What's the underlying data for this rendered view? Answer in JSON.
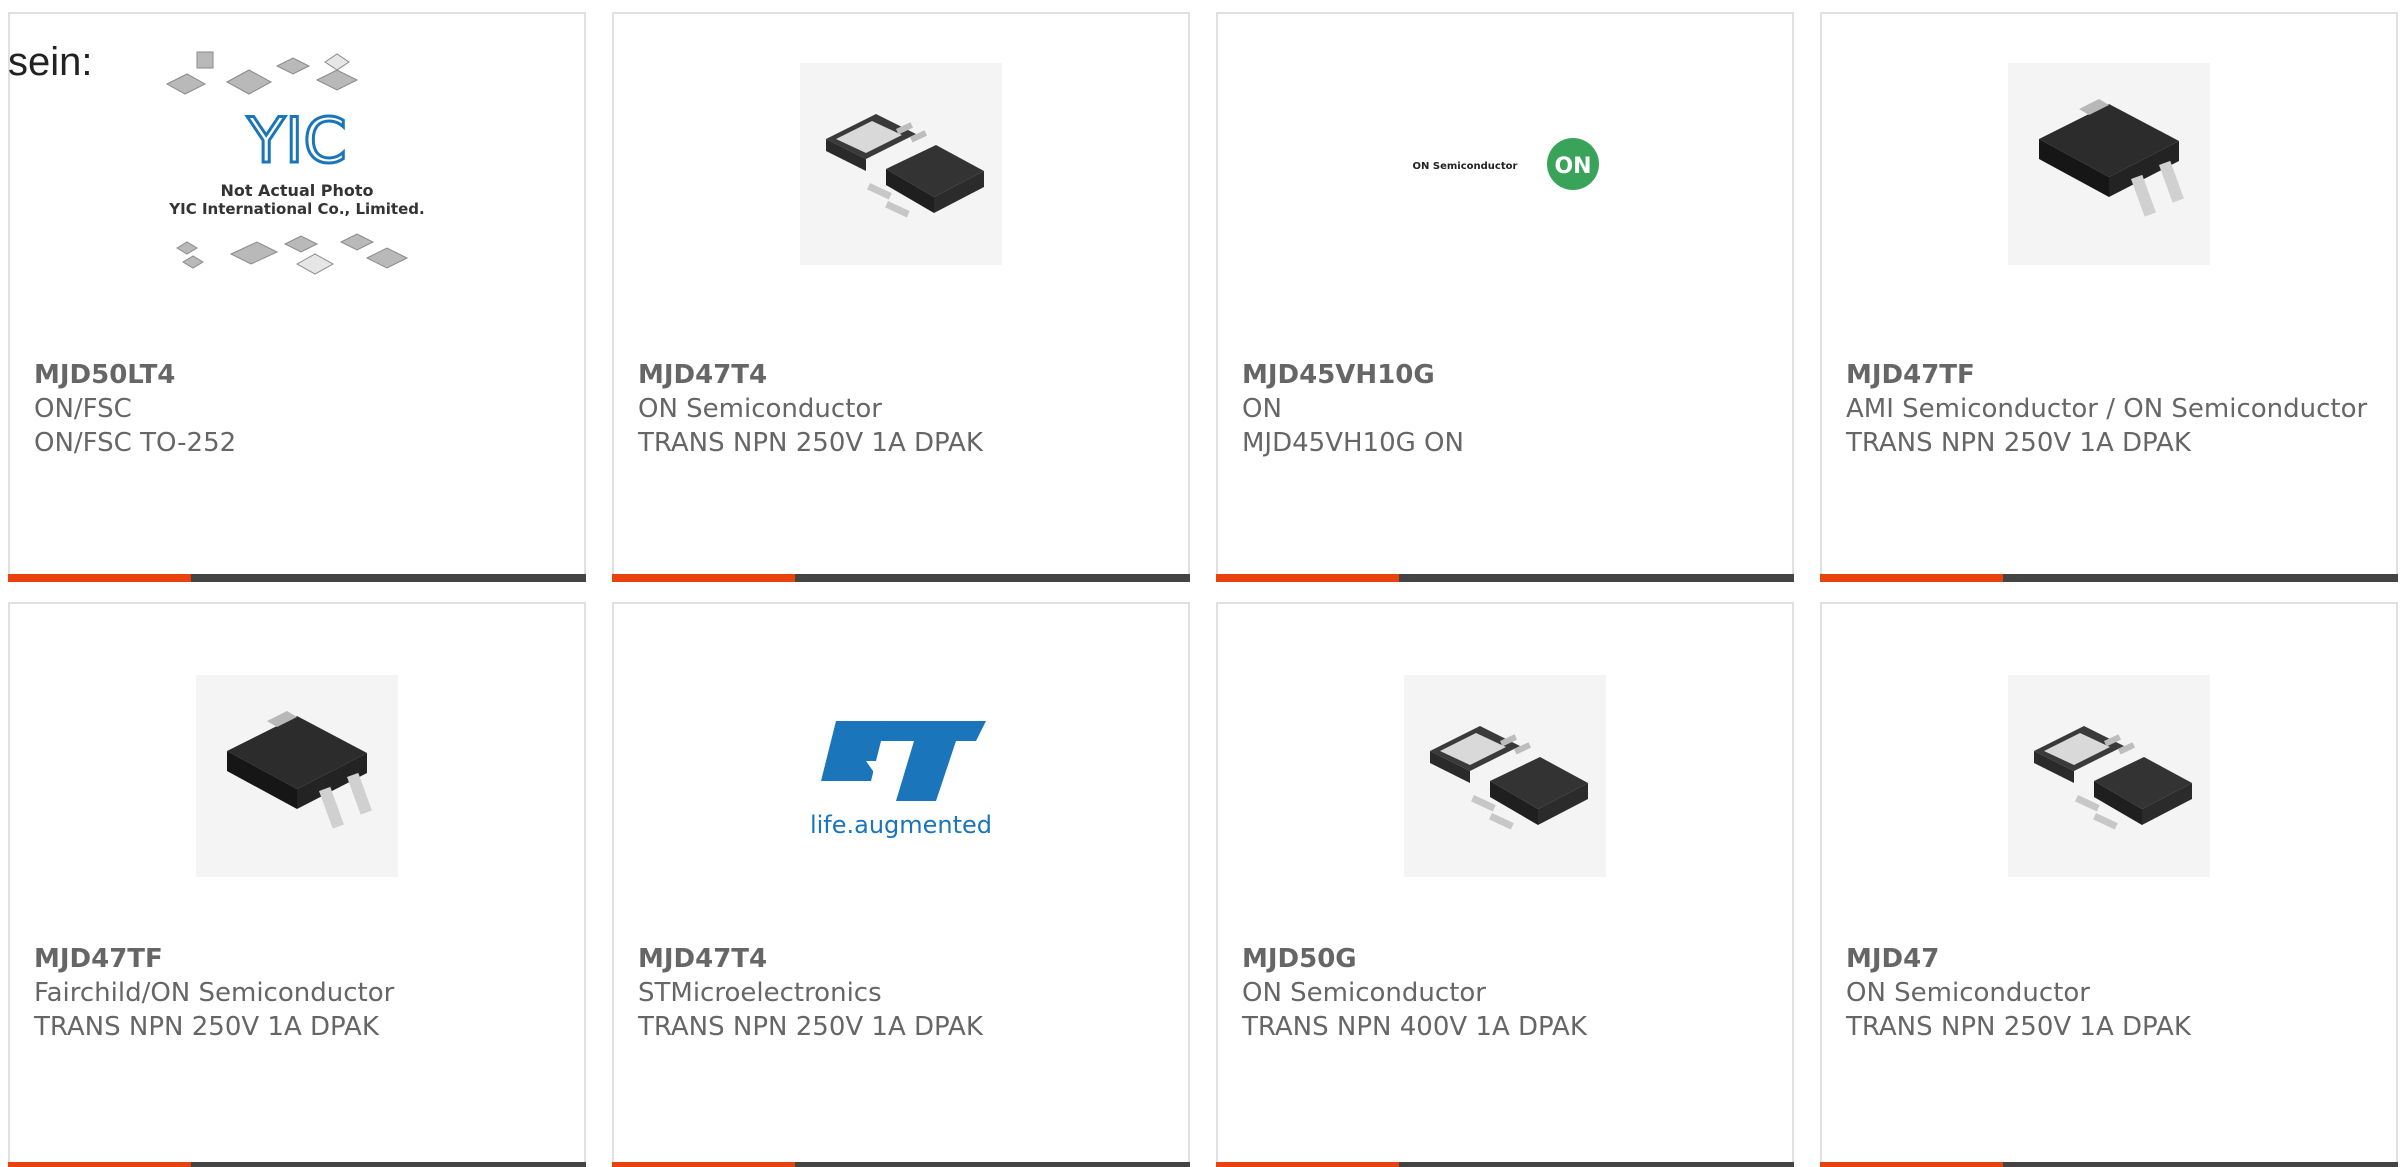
{
  "heading": "sein:",
  "colors": {
    "accent": "#e8430f",
    "bar": "#444444",
    "border": "#e0e0e0",
    "text": "#666666",
    "on_green": "#3aa35a",
    "st_blue": "#1b75bb"
  },
  "placeholder": {
    "logo_text": "YIC",
    "line1": "Not Actual Photo",
    "line2": "YIC International Co., Limited."
  },
  "on_logo": {
    "wordmark": "ON Semiconductor",
    "badge": "ON"
  },
  "st_logo": {
    "tagline": "life.augmented"
  },
  "products": [
    {
      "part": "MJD50LT4",
      "manufacturer": "ON/FSC",
      "description": "ON/FSC TO-252",
      "image": "yic-placeholder"
    },
    {
      "part": "MJD47T4",
      "manufacturer": "ON Semiconductor",
      "description": "TRANS NPN 250V 1A DPAK",
      "image": "dpak-pair"
    },
    {
      "part": "MJD45VH10G",
      "manufacturer": "ON",
      "description": "MJD45VH10G ON",
      "image": "on-semiconductor-logo"
    },
    {
      "part": "MJD47TF",
      "manufacturer": "AMI Semiconductor / ON Semiconductor",
      "description": "TRANS NPN 250V 1A DPAK",
      "image": "dpak-single"
    },
    {
      "part": "MJD47TF",
      "manufacturer": "Fairchild/ON Semiconductor",
      "description": "TRANS NPN 250V 1A DPAK",
      "image": "dpak-single"
    },
    {
      "part": "MJD47T4",
      "manufacturer": "STMicroelectronics",
      "description": "TRANS NPN 250V 1A DPAK",
      "image": "st-logo"
    },
    {
      "part": "MJD50G",
      "manufacturer": "ON Semiconductor",
      "description": "TRANS NPN 400V 1A DPAK",
      "image": "dpak-pair"
    },
    {
      "part": "MJD47",
      "manufacturer": "ON Semiconductor",
      "description": "TRANS NPN 250V 1A DPAK",
      "image": "dpak-pair"
    }
  ]
}
